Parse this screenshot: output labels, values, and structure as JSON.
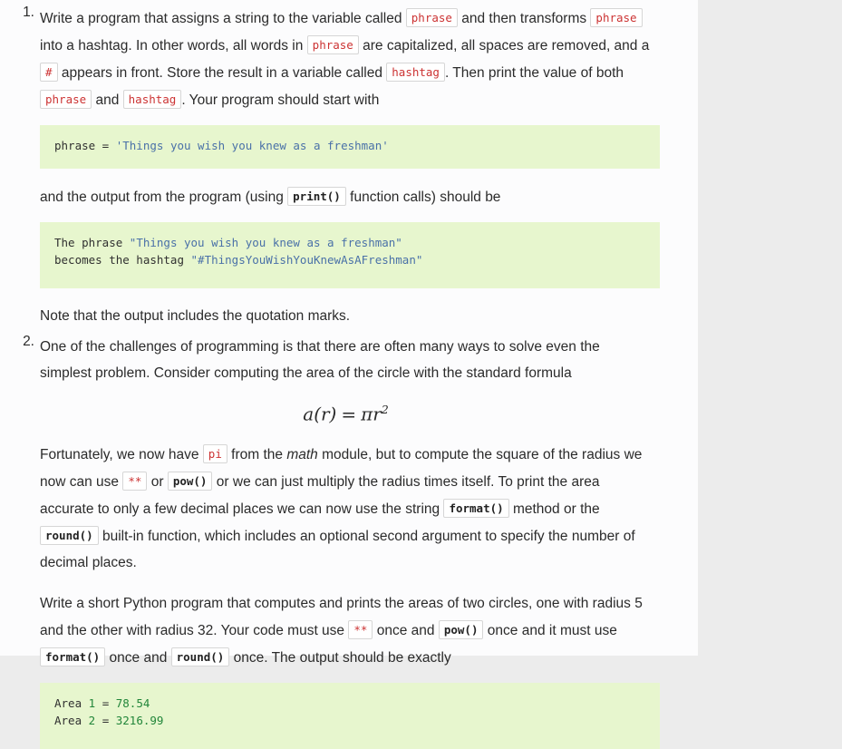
{
  "colors": {
    "page_background": "#ececec",
    "content_background": "#fcfcfd",
    "code_block_background": "#e7f6ce",
    "inline_code_text": "#cc3333",
    "inline_code_border": "#d6d6d6",
    "body_text": "#2b2b2b",
    "code_string": "#4a71a8",
    "code_number": "#22863a"
  },
  "problems": [
    {
      "marker": "1.",
      "para1": {
        "s1": "Write a program that assigns a string to the variable called",
        "code1": "phrase",
        "s2": "and then transforms",
        "code2": "phrase",
        "s3": "into a hashtag. In other words, all words in",
        "code3": "phrase",
        "s4": "are capitalized, all spaces are removed, and a",
        "code4": "#",
        "s5": "appears in front. Store the result in a variable called",
        "code5": "hashtag",
        "s6": ". Then print the value of both",
        "code6": "phrase",
        "s7": "and",
        "code7": "hashtag",
        "s8": ". Your program should start with"
      },
      "code_block_1": {
        "prefix": "phrase = ",
        "string": "'Things you wish you knew as a freshman'"
      },
      "para2": {
        "s1": "and the output from the program (using",
        "code1": "print()",
        "s2": "function calls) should be"
      },
      "code_block_2": {
        "line1_prefix": "The phrase ",
        "line1_string": "\"Things you wish you knew as a freshman\"",
        "line2_prefix": "becomes the hashtag ",
        "line2_string": "\"#ThingsYouWishYouKnewAsAFreshman\""
      },
      "para3": "Note that the output includes the quotation marks."
    },
    {
      "marker": "2.",
      "para1": "One of the challenges of programming is that there are often many ways to solve even the simplest problem. Consider computing the area of the circle with the standard formula",
      "formula": {
        "lhs": "a(r)",
        "equals": "=",
        "pi": "π",
        "var": "r",
        "exponent": "2",
        "plain": "a(r) = πr²"
      },
      "para2": {
        "s1": "Fortunately, we now have",
        "code1": "pi",
        "s2": "from the",
        "em1": "math",
        "s3": "module, but to compute the square of the radius we now can use",
        "code2": "**",
        "s4": "or",
        "code3": "pow()",
        "s5": "or we can just multiply the radius times itself. To print the area accurate to only a few decimal places we can now use the string",
        "code4": "format()",
        "s6": "method or the",
        "code5": "round()",
        "s7": "built-in function, which includes an optional second argument to specify the number of decimal places."
      },
      "para3": {
        "s1": "Write a short Python program that computes and prints the areas of two circles, one with radius 5 and the other with radius 32. Your code must use",
        "code1": "**",
        "s2": "once and",
        "code2": "pow()",
        "s3": "once and it must use",
        "code3": "format()",
        "s4": "once and",
        "code4": "round()",
        "s5": "once. The output should be exactly"
      },
      "code_block_1": {
        "line1_prefix": "Area ",
        "line1_num1": "1",
        "line1_mid": " = ",
        "line1_num2": "78.54",
        "line2_prefix": "Area ",
        "line2_num1": "2",
        "line2_mid": " = ",
        "line2_num2": "3216.99"
      }
    }
  ]
}
